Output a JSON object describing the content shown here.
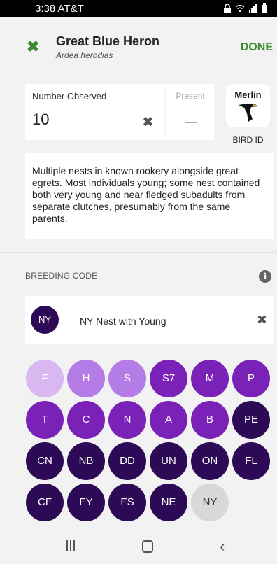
{
  "status_bar": {
    "time": "3:38",
    "carrier": "AT&T"
  },
  "header": {
    "common_name": "Great Blue Heron",
    "scientific_name": "Ardea herodias",
    "close_icon": "close-icon",
    "done_label": "DONE",
    "accent": "#3d8b2f"
  },
  "count": {
    "label": "Number Observed",
    "value": "10",
    "clear_icon": "clear-icon"
  },
  "present": {
    "label": "Present",
    "checked": false
  },
  "merlin": {
    "wordmark": "Merlin",
    "caption": "BIRD ID"
  },
  "comments": "Multiple nests in known rookery alongside great egrets. Most individuals young; some nest contained both very young and near fledged subadults from separate clutches, presumably from the same parents.",
  "breeding": {
    "section_label": "BREEDING CODE",
    "info_icon": "i",
    "selected_code": "NY",
    "selected_description": "NY Nest with Young",
    "codes": [
      {
        "code": "F",
        "color": "#d9b8f2"
      },
      {
        "code": "H",
        "color": "#b57be6"
      },
      {
        "code": "S",
        "color": "#b57be6"
      },
      {
        "code": "S7",
        "color": "#7a22b8"
      },
      {
        "code": "M",
        "color": "#7a22b8"
      },
      {
        "code": "P",
        "color": "#7a22b8"
      },
      {
        "code": "T",
        "color": "#7a22b8"
      },
      {
        "code": "C",
        "color": "#7a22b8"
      },
      {
        "code": "N",
        "color": "#7a22b8"
      },
      {
        "code": "A",
        "color": "#7a22b8"
      },
      {
        "code": "B",
        "color": "#7a22b8"
      },
      {
        "code": "PE",
        "color": "#2d0a55"
      },
      {
        "code": "CN",
        "color": "#2d0a55"
      },
      {
        "code": "NB",
        "color": "#2d0a55"
      },
      {
        "code": "DD",
        "color": "#2d0a55"
      },
      {
        "code": "UN",
        "color": "#2d0a55"
      },
      {
        "code": "ON",
        "color": "#2d0a55"
      },
      {
        "code": "FL",
        "color": "#2d0a55"
      },
      {
        "code": "CF",
        "color": "#2d0a55"
      },
      {
        "code": "FY",
        "color": "#2d0a55"
      },
      {
        "code": "FS",
        "color": "#2d0a55"
      },
      {
        "code": "NE",
        "color": "#2d0a55"
      },
      {
        "code": "NY",
        "color": "#d8d8d8",
        "selected": true
      }
    ]
  },
  "nav": {
    "recent_icon": "recent-apps-icon",
    "home_icon": "home-icon",
    "back_icon": "back-icon"
  }
}
